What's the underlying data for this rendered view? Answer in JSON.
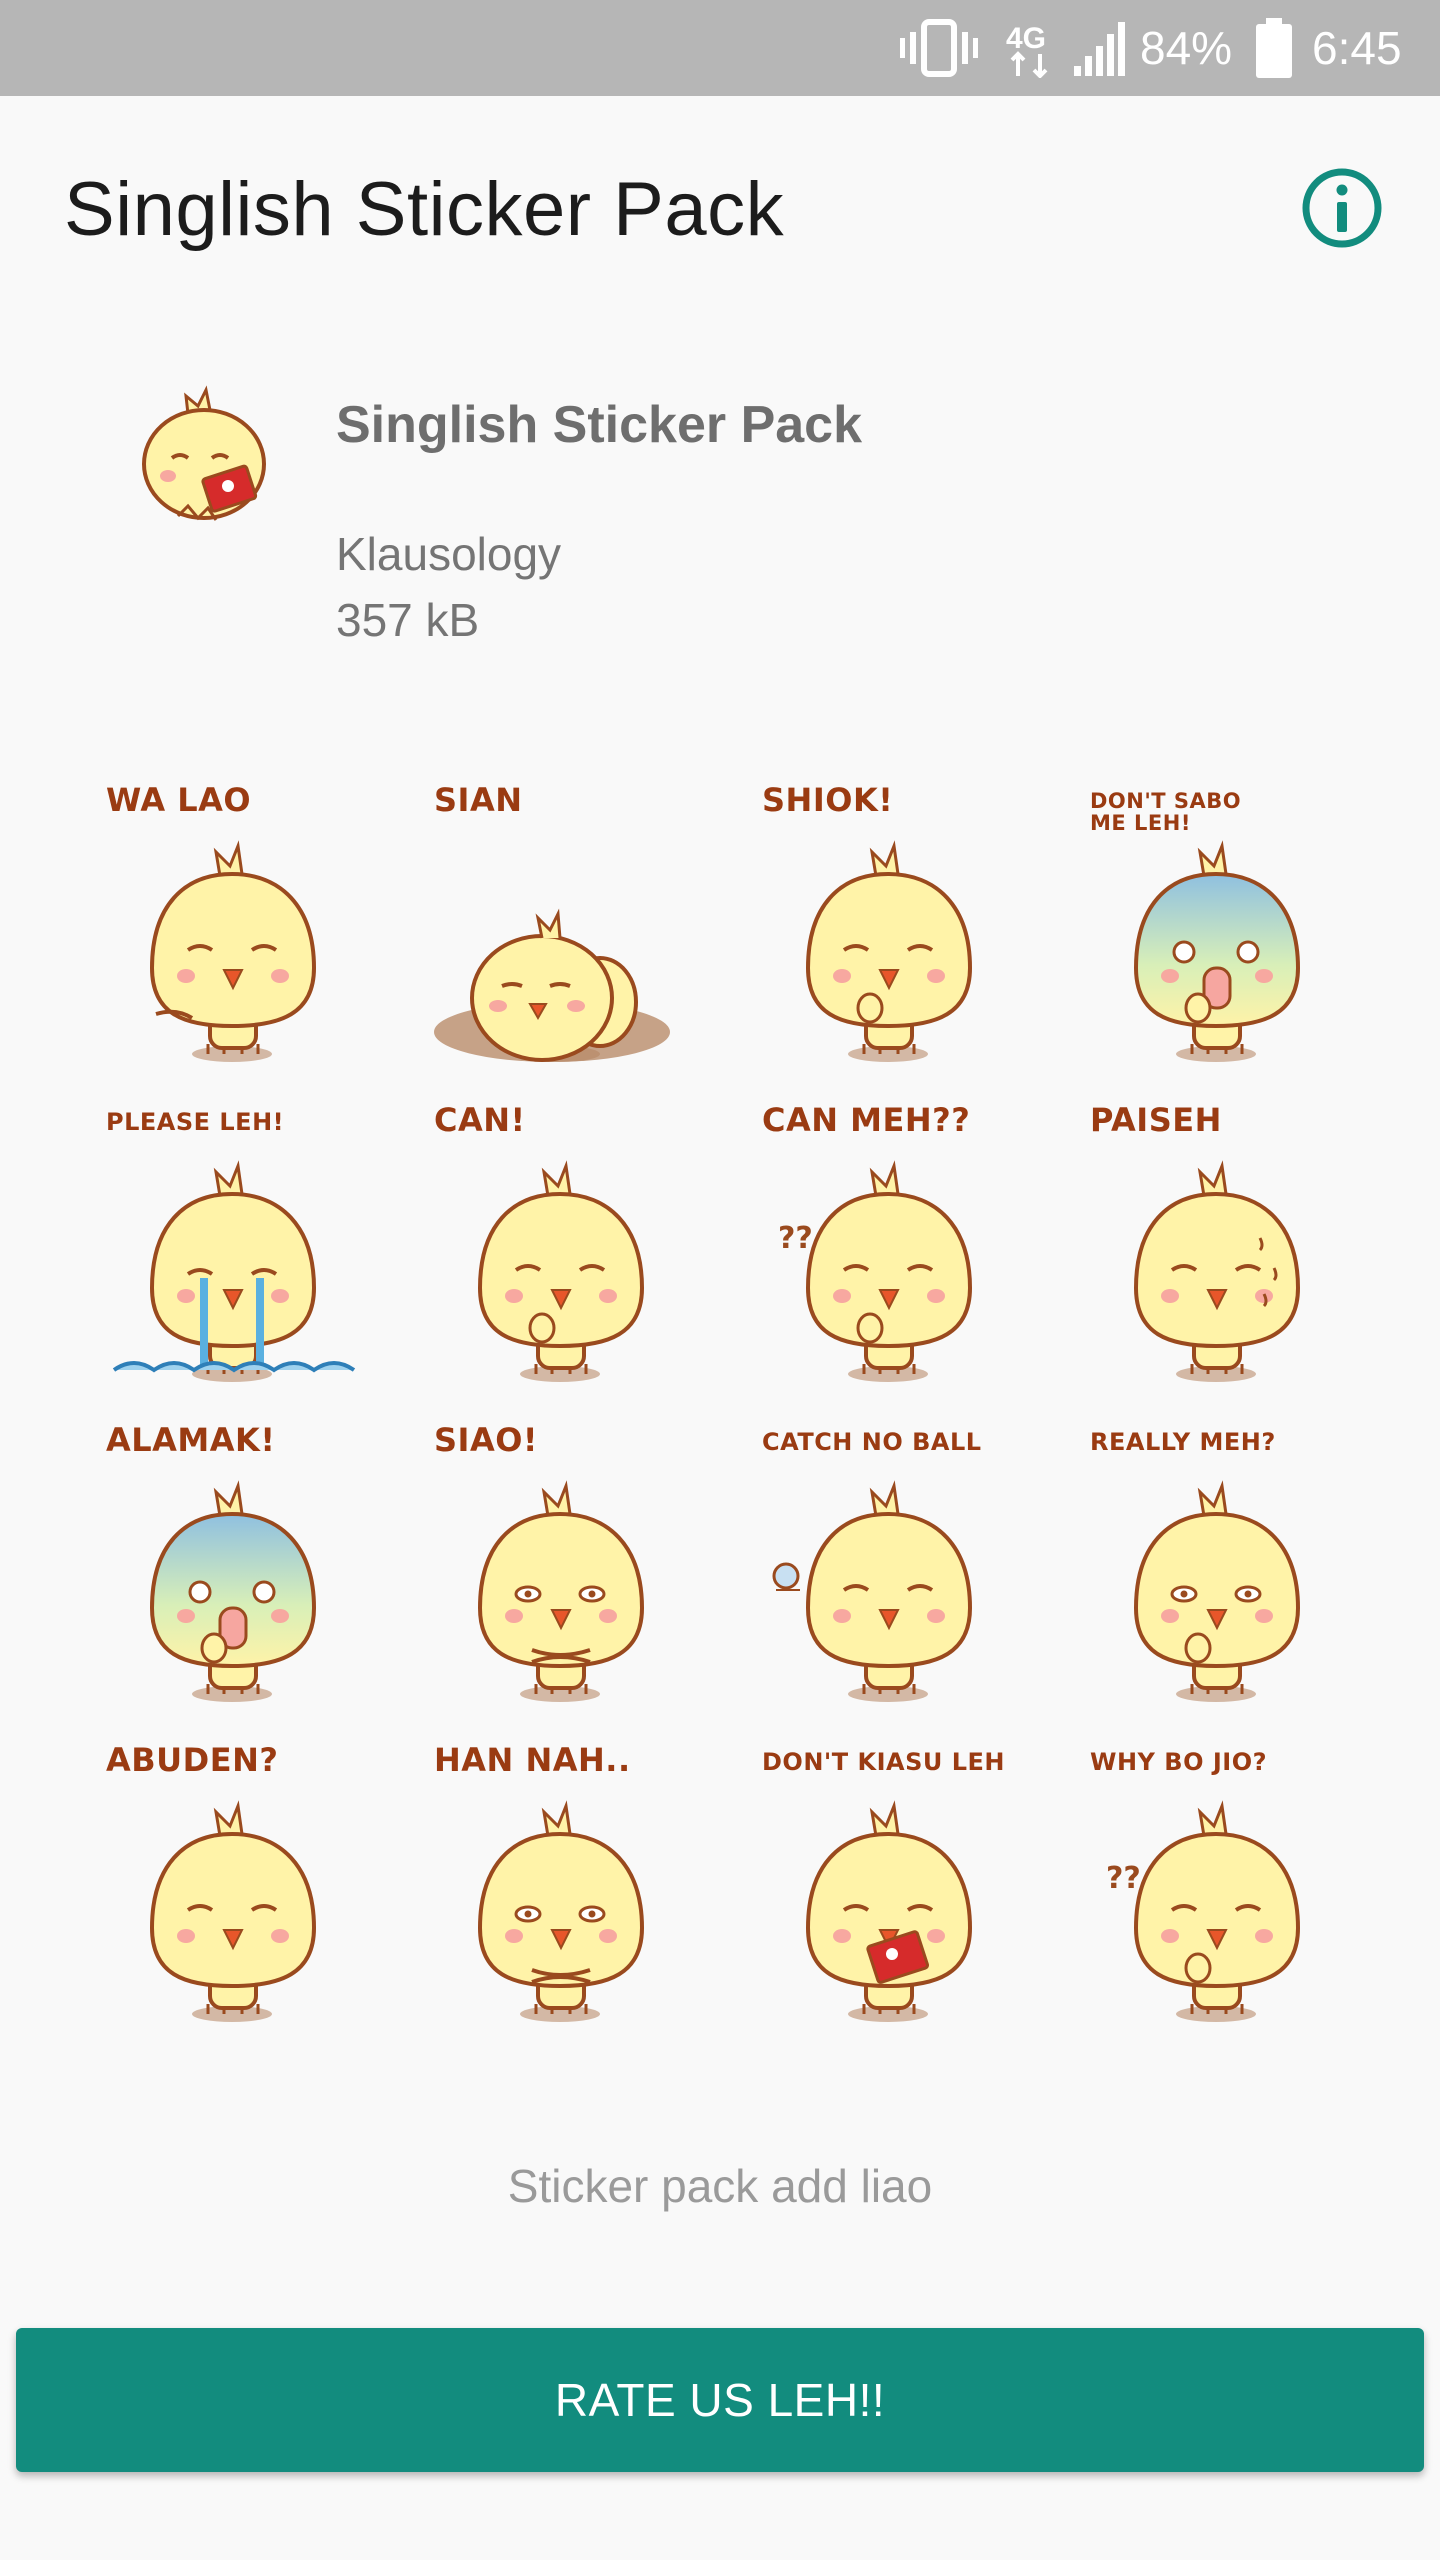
{
  "status_bar": {
    "battery_percent": "84%",
    "time": "6:45",
    "network_label": "4G",
    "icons": [
      "vibrate-icon",
      "network-4g-icon",
      "signal-icon",
      "battery-icon"
    ]
  },
  "app_bar": {
    "title": "Singlish Sticker Pack",
    "info_icon": "info-icon",
    "accent_color": "#128c7e"
  },
  "pack": {
    "name": "Singlish Sticker Pack",
    "publisher": "Klausology",
    "size": "357 kB"
  },
  "stickers": [
    {
      "caption": "WA LAO",
      "pose": "pointing"
    },
    {
      "caption": "SIAN",
      "pose": "lying"
    },
    {
      "caption": "SHIOK!",
      "pose": "thumb"
    },
    {
      "caption": "DON'T SABO\nME LEH!",
      "pose": "shock"
    },
    {
      "caption": "PLEASE LEH!",
      "pose": "crying"
    },
    {
      "caption": "CAN!",
      "pose": "thumb"
    },
    {
      "caption": "CAN MEH??",
      "pose": "question"
    },
    {
      "caption": "PAISEH",
      "pose": "sweat"
    },
    {
      "caption": "ALAMAK!",
      "pose": "shock"
    },
    {
      "caption": "SIAO!",
      "pose": "arms"
    },
    {
      "caption": "CATCH NO BALL",
      "pose": "ball"
    },
    {
      "caption": "REALLY MEH?",
      "pose": "doubt"
    },
    {
      "caption": "ABUDEN?",
      "pose": "plain"
    },
    {
      "caption": "HAN NAH..",
      "pose": "arms"
    },
    {
      "caption": "DON'T KIASU LEH",
      "pose": "flag"
    },
    {
      "caption": "WHY BO JIO?",
      "pose": "question"
    }
  ],
  "footer": {
    "added_text": "Sticker pack add liao",
    "rate_button": "RATE US LEH!!"
  },
  "colors": {
    "status_bar": "#b6b6b6",
    "button": "#128c7e",
    "caption": "#9a3b12",
    "chick_body": "#fff3a8",
    "chick_outline": "#9a4a1e"
  }
}
